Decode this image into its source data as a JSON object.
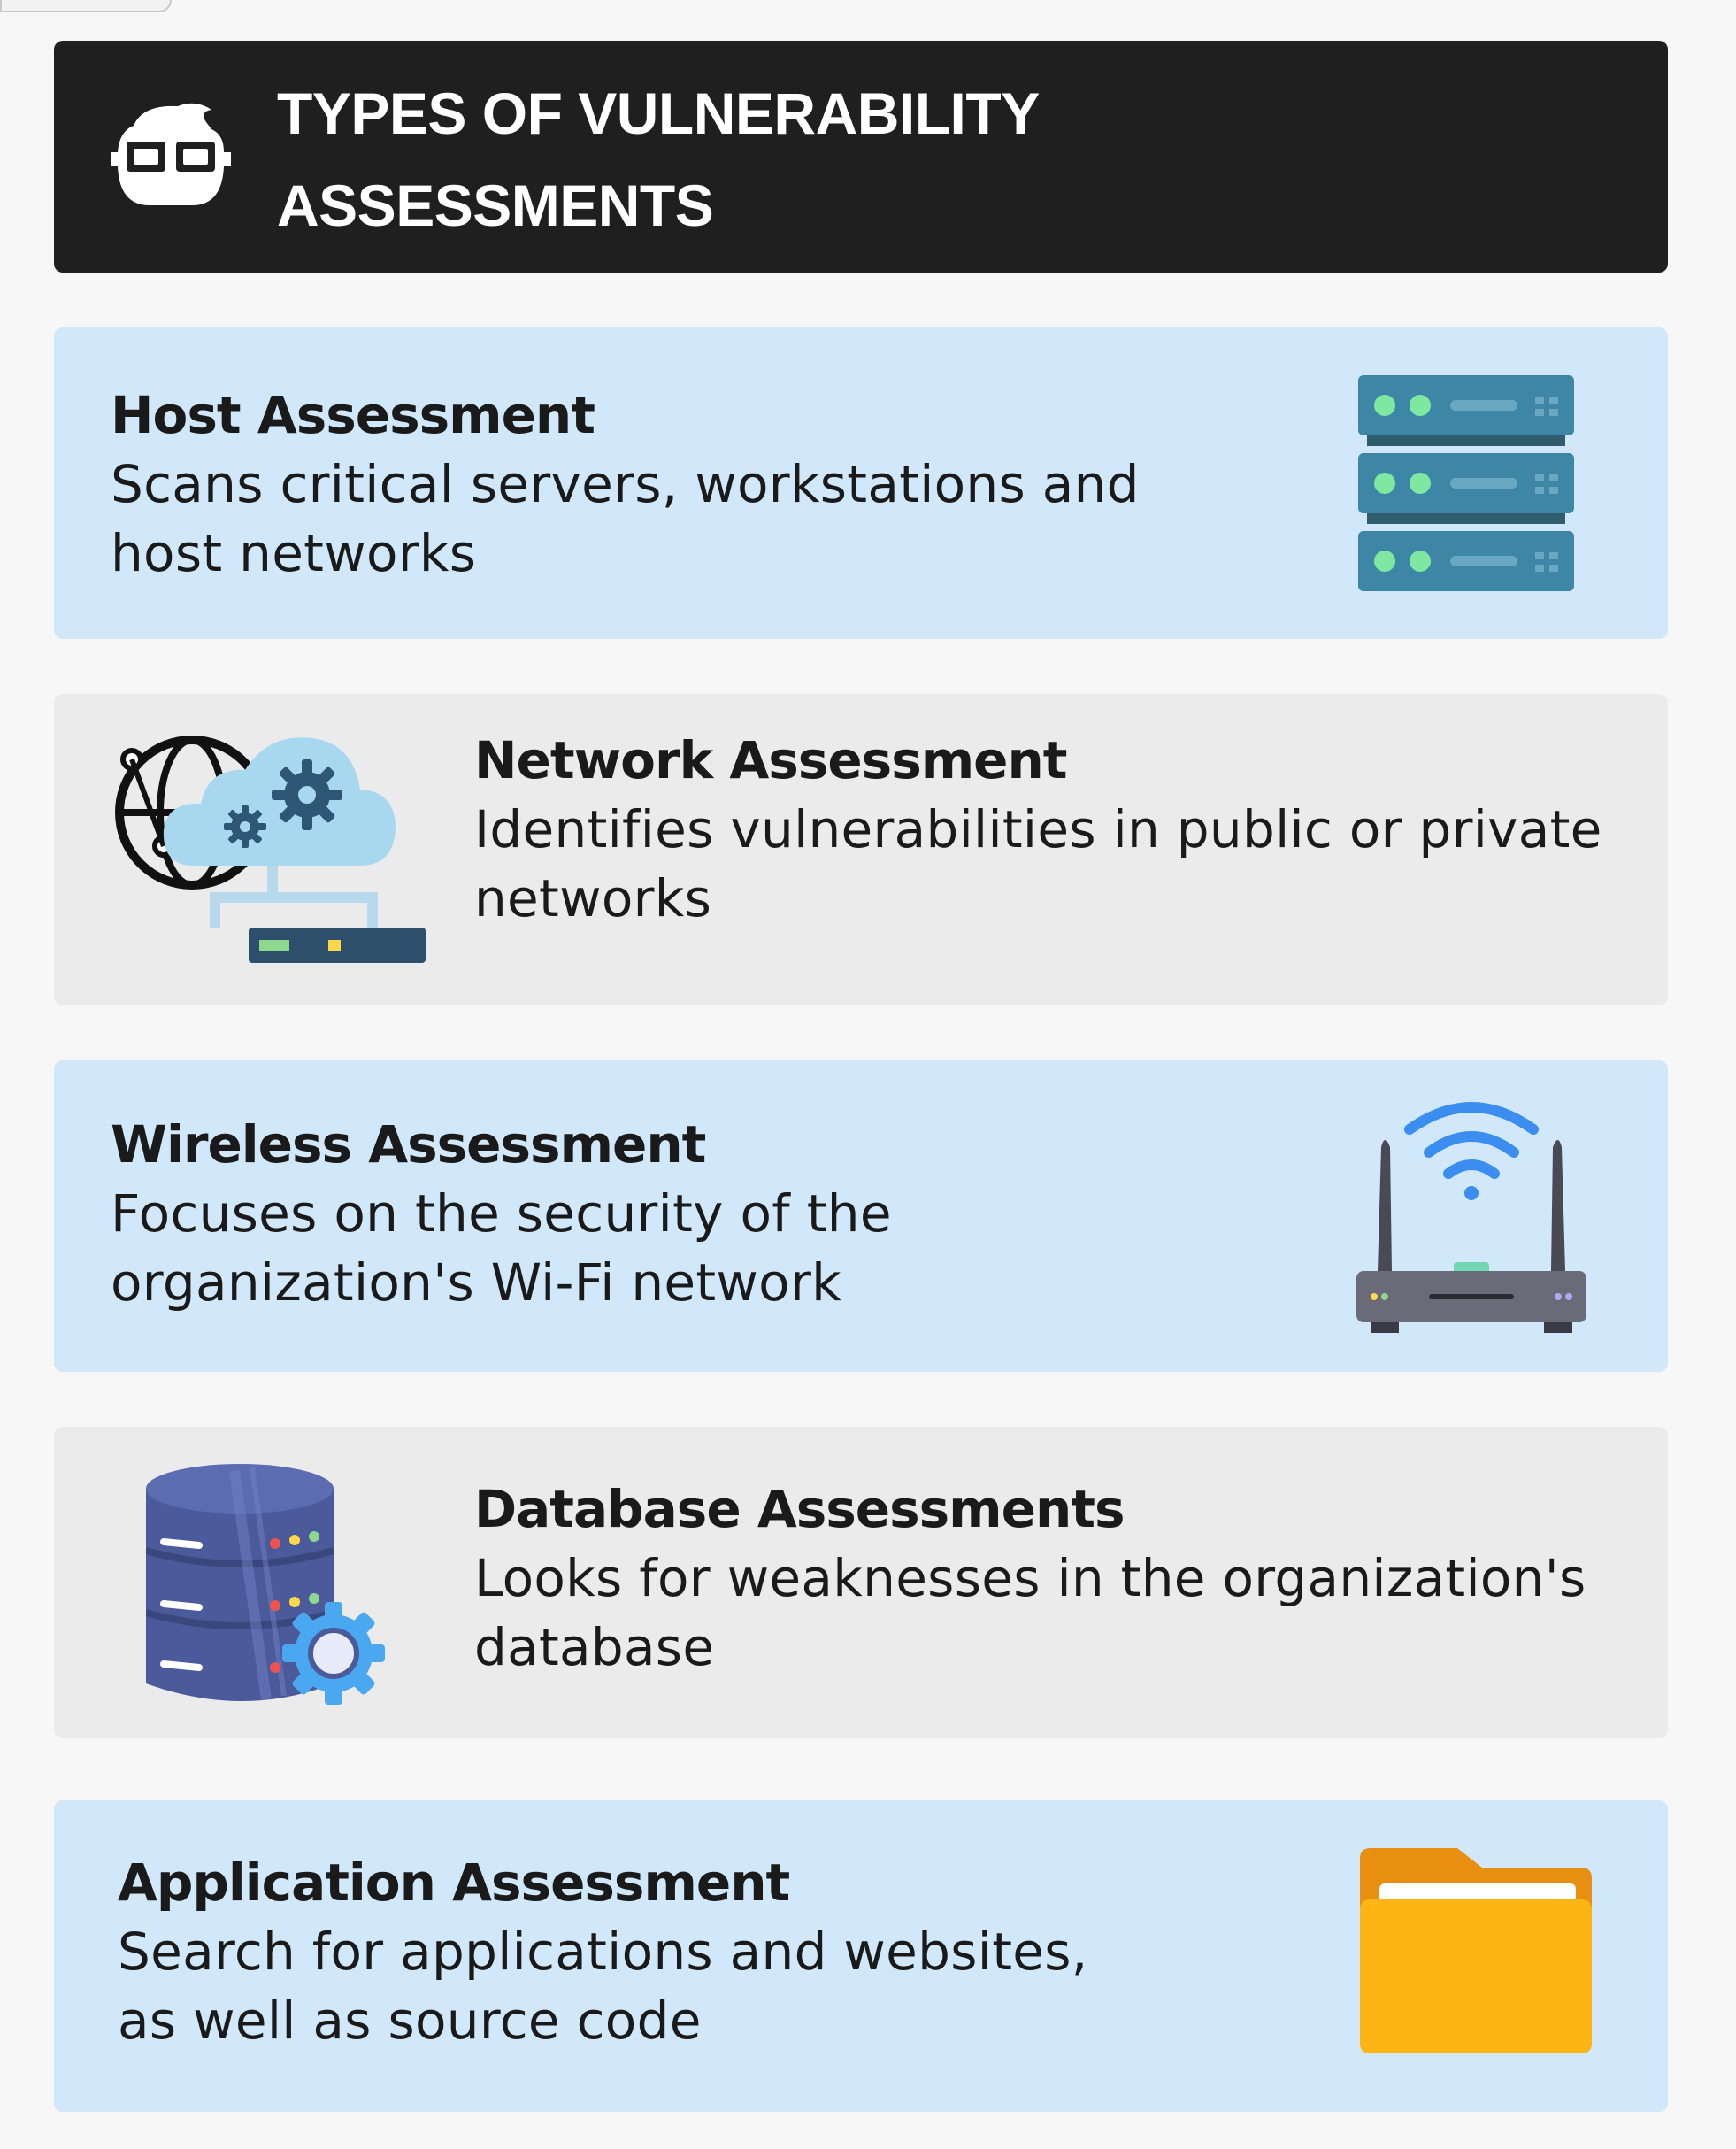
{
  "header": {
    "title_line1": "TYPES OF VULNERABILITY",
    "title_line2": "ASSESSMENTS",
    "logo_icon": "robot-face-icon"
  },
  "cards": [
    {
      "title": "Host Assessment",
      "desc_line1": "Scans critical servers, workstations and",
      "desc_line2": "host networks",
      "icon": "server-rack-icon",
      "background": "#d0e8fa"
    },
    {
      "title": "Network Assessment",
      "desc_line1": "Identifies vulnerabilities in public or private",
      "desc_line2": "networks",
      "icon": "cloud-network-icon",
      "background": "#ebebeb"
    },
    {
      "title": "Wireless Assessment",
      "desc_line1": "Focuses on the security of the",
      "desc_line2": "organization's Wi-Fi network",
      "icon": "wifi-router-icon",
      "background": "#d0e8fa"
    },
    {
      "title": "Database Assessments",
      "desc_line1": "Looks for weaknesses in the organization's",
      "desc_line2": "database",
      "icon": "database-gear-icon",
      "background": "#ebebeb"
    },
    {
      "title": "Application Assessment",
      "desc_line1": "Search for applications and websites,",
      "desc_line2": "as well as source code",
      "icon": "folder-icon",
      "background": "#d0e8fa"
    }
  ],
  "colors": {
    "header_bg": "#1f1f1f",
    "card_blue": "#d0e8fa",
    "card_gray": "#ebebeb",
    "page_bg": "#f7f7f7"
  }
}
